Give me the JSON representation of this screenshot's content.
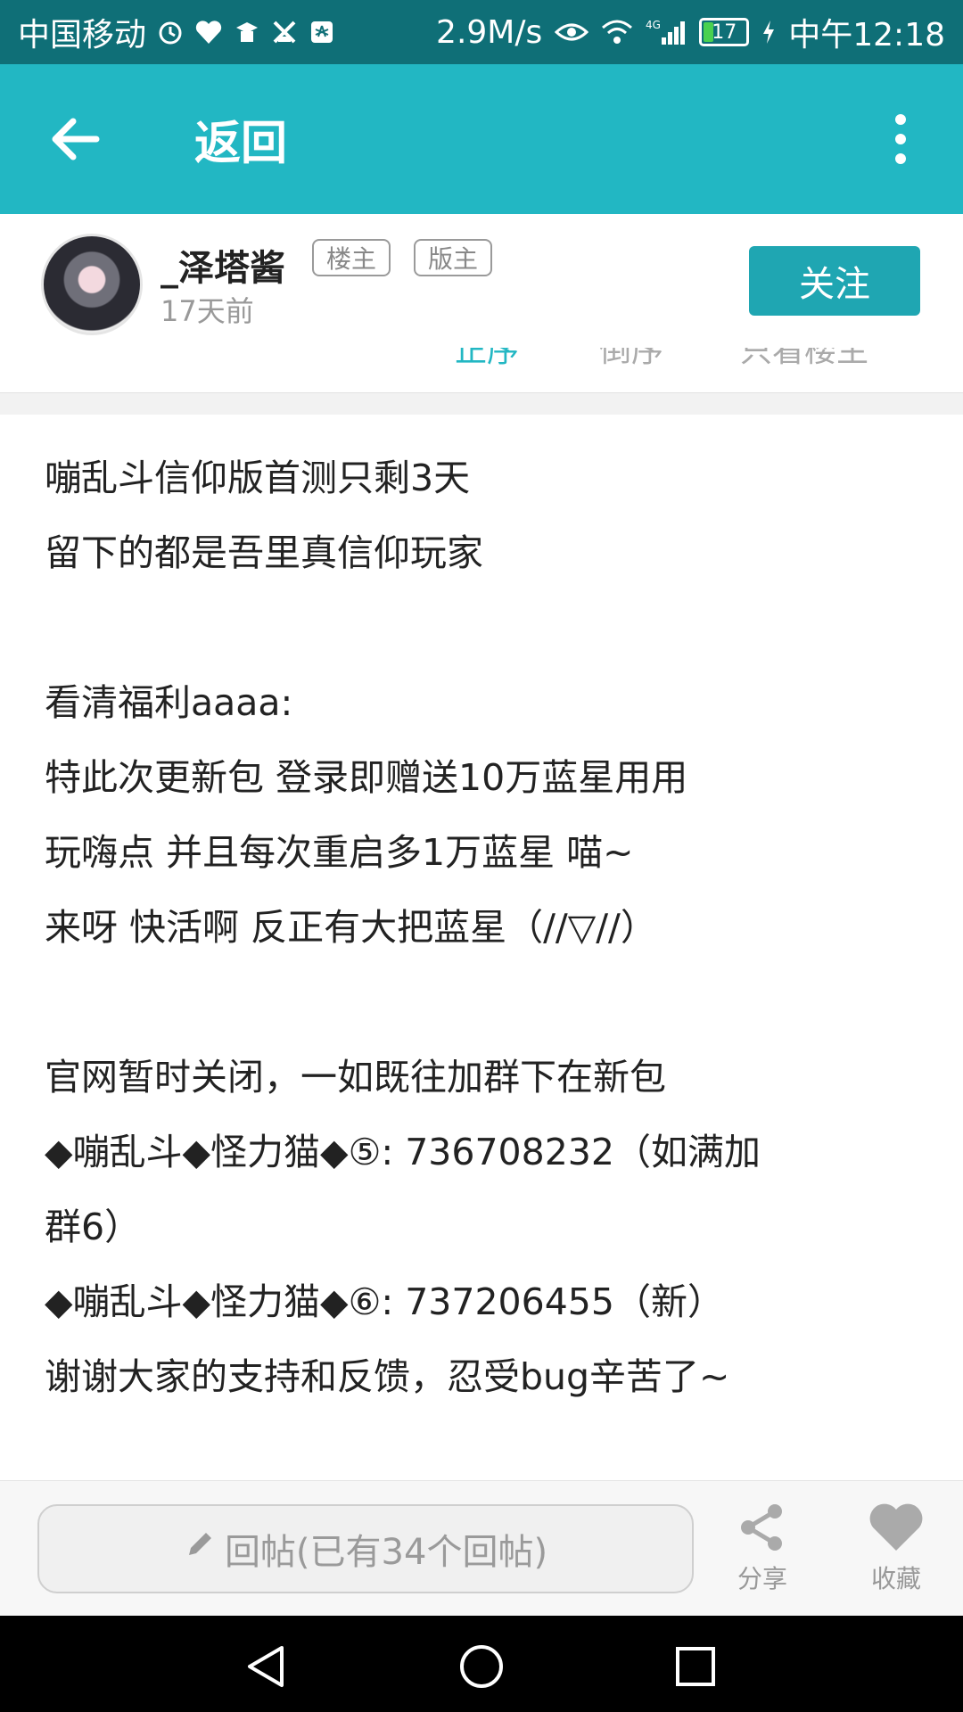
{
  "status_bar": {
    "carrier": "中国移动",
    "speed": "2.9M/s",
    "network": "4G",
    "battery": "17",
    "time": "中午12:18"
  },
  "app_bar": {
    "title": "返回"
  },
  "author": {
    "name": "_泽塔酱",
    "tag_op": "楼主",
    "tag_mod": "版主",
    "time": "17天前",
    "follow_label": "关注"
  },
  "sort_row": {
    "sort_asc": "正序",
    "sort_desc": "倒序",
    "only_op": "只看楼主"
  },
  "post": {
    "lines": [
      "嘣乱斗信仰版首测只剩3天",
      "留下的都是吾里真信仰玩家",
      "",
      "看清福利aaaa:",
      "特此次更新包 登录即赠送10万蓝星用用",
      "玩嗨点 并且每次重启多1万蓝星 喵~",
      "来呀 快活啊 反正有大把蓝星（//▽//）",
      "",
      "官网暂时关闭，一如既往加群下在新包",
      "◆嘣乱斗◆怪力猫◆⑤: 736708232（如满加",
      "群6）",
      "◆嘣乱斗◆怪力猫◆⑥: 737206455（新）",
      "谢谢大家的支持和反馈，忍受bug辛苦了~"
    ]
  },
  "bottom_bar": {
    "reply_placeholder": "回帖(已有34个回帖)",
    "share_label": "分享",
    "favorite_label": "收藏"
  },
  "colors": {
    "status_bar_bg": "#0f6f77",
    "app_bar_bg": "#22b7c3",
    "follow_bg": "#1fa6b2"
  }
}
